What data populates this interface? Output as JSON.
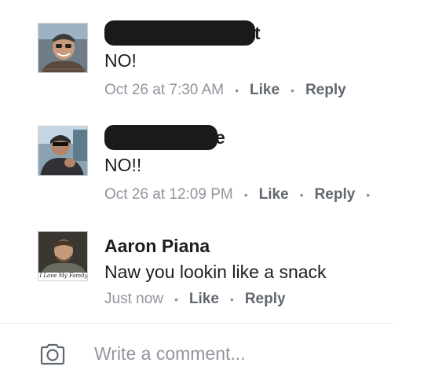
{
  "comments": [
    {
      "author_visible": "t",
      "text": "NO!",
      "timestamp": "Oct 26 at 7:30 AM",
      "like_label": "Like",
      "reply_label": "Reply",
      "dot": "•"
    },
    {
      "author_visible": "e",
      "text": "NO!!",
      "timestamp": "Oct 26 at 12:09 PM",
      "like_label": "Like",
      "reply_label": "Reply",
      "dot": "•"
    },
    {
      "author": "Aaron Piana",
      "text": "Naw you lookin like a snack",
      "timestamp": "Just now",
      "like_label": "Like",
      "reply_label": "Reply",
      "dot": "•",
      "avatar_caption": "I Love My Family"
    }
  ],
  "composer": {
    "placeholder": "Write a comment..."
  },
  "colors": {
    "meta_text": "#90949c",
    "link_text": "#616770",
    "body_text": "#1c1e21",
    "redaction": "#1a1a1a"
  },
  "icons": {
    "composer_camera": "camera-icon"
  }
}
